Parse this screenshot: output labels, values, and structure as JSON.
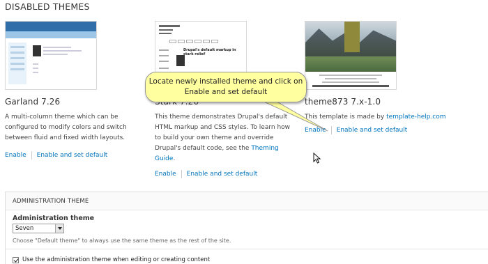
{
  "section_title": "DISABLED THEMES",
  "themes": [
    {
      "name": "Garland 7.26",
      "description": "A multi-column theme which can be configured to modify colors and switch between fluid and fixed width layouts.",
      "enable_label": "Enable",
      "enable_default_label": "Enable and set default"
    },
    {
      "name": "Stark 7.26",
      "description": "This theme demonstrates Drupal's default HTML markup and CSS styles. To learn how to build your own theme and override Drupal's default code, see the",
      "description_link": "Theming Guide",
      "description_end": ".",
      "screenshot_title": "Drupal's default markup in stark relief",
      "enable_label": "Enable",
      "enable_default_label": "Enable and set default"
    },
    {
      "name": "theme873 7.x-1.0",
      "description": "This template is made by",
      "description_link": "template-help.com",
      "enable_label": "Enable",
      "enable_default_label": "Enable and set default"
    }
  ],
  "callout": {
    "line1": "Locate newly installed theme and click on",
    "line2": "Enable and set default"
  },
  "admin": {
    "legend": "ADMINISTRATION THEME",
    "label": "Administration theme",
    "selected": "Seven",
    "hint": "Choose \"Default theme\" to always use the same theme as the rest of the site.",
    "checkbox_label": "Use the administration theme when editing or creating content",
    "checked": true
  }
}
